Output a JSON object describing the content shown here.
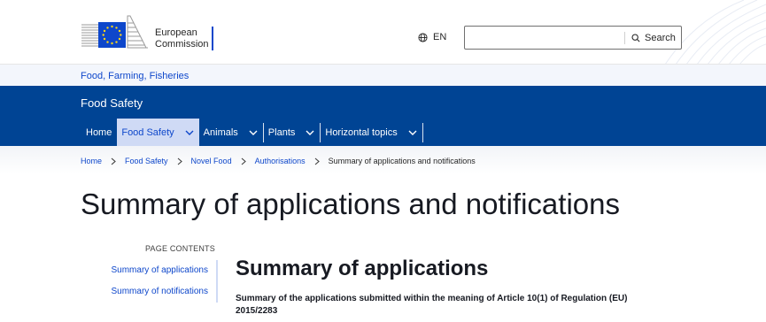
{
  "header": {
    "logo_line1": "European",
    "logo_line2": "Commission",
    "language": "EN",
    "search": {
      "value": "",
      "placeholder": "",
      "button_label": "Search"
    }
  },
  "subsite": {
    "label": "Food, Farming, Fisheries"
  },
  "site_name": "Food Safety",
  "menu": [
    {
      "label": "Home",
      "active": false,
      "has_dropdown": false
    },
    {
      "label": "Food Safety",
      "active": true,
      "has_dropdown": true
    },
    {
      "label": "Animals",
      "active": false,
      "has_dropdown": true
    },
    {
      "label": "Plants",
      "active": false,
      "has_dropdown": true
    },
    {
      "label": "Horizontal topics",
      "active": false,
      "has_dropdown": true
    }
  ],
  "breadcrumb": {
    "items": [
      "Home",
      "Food Safety",
      "Novel Food",
      "Authorisations"
    ],
    "current": "Summary of applications and notifications"
  },
  "page_title": "Summary of applications and notifications",
  "page_contents": {
    "heading": "PAGE CONTENTS",
    "links": [
      "Summary of applications",
      "Summary of notifications"
    ]
  },
  "section": {
    "title": "Summary of applications",
    "subtitle": "Summary of the applications submitted within the meaning of Article 10(1) of Regulation (EU) 2015/2283"
  },
  "colors": {
    "primary_blue": "#004494",
    "link_blue": "#0e47cb",
    "active_menu_bg": "#cfdaf5",
    "flag_blue": "#0e47cb",
    "star_yellow": "#ffd617"
  },
  "icons": [
    "globe-icon",
    "search-icon",
    "chevron-down-icon",
    "chevron-right-icon",
    "eu-flag-logo"
  ]
}
